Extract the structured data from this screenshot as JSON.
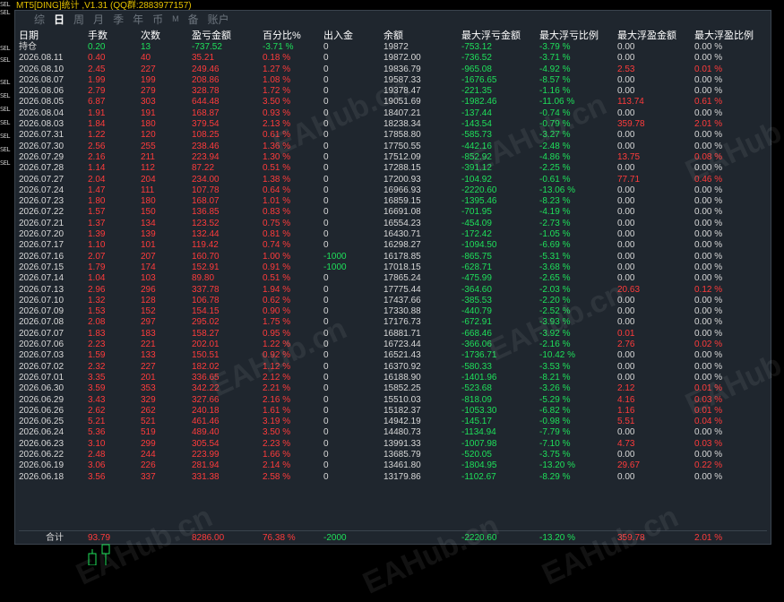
{
  "title": "MT5[DING]统计 ,V1.31 (QQ群:2883977157)",
  "tabs": [
    {
      "label": "综",
      "active": false
    },
    {
      "label": "日",
      "active": true
    },
    {
      "label": "周",
      "active": false
    },
    {
      "label": "月",
      "active": false
    },
    {
      "label": "季",
      "active": false
    },
    {
      "label": "年",
      "active": false
    },
    {
      "label": "币",
      "active": false
    },
    {
      "label": "M",
      "active": false
    },
    {
      "label": "备",
      "active": false
    },
    {
      "label": "账户",
      "active": false
    }
  ],
  "columns": [
    "日期",
    "手数",
    "次数",
    "盈亏金额",
    "百分比%",
    "出入金",
    "余额",
    "最大浮亏金额",
    "最大浮亏比例",
    "最大浮盈金额",
    "最大浮盈比例"
  ],
  "holding": [
    "持仓",
    "0.20",
    "13",
    "-737.52",
    "-3.71 %",
    "0",
    "19872",
    "-753.12",
    "-3.79 %",
    "0.00",
    "0.00 %"
  ],
  "rows": [
    [
      "2026.08.11",
      "0.40",
      "40",
      "35.21",
      "0.18 %",
      "0",
      "19872.00",
      "-736.52",
      "-3.71 %",
      "0.00",
      "0.00 %"
    ],
    [
      "2026.08.10",
      "2.45",
      "227",
      "249.46",
      "1.27 %",
      "0",
      "19836.79",
      "-965.08",
      "-4.92 %",
      "2.53",
      "0.01 %"
    ],
    [
      "2026.08.07",
      "1.99",
      "199",
      "208.86",
      "1.08 %",
      "0",
      "19587.33",
      "-1676.65",
      "-8.57 %",
      "0.00",
      "0.00 %"
    ],
    [
      "2026.08.06",
      "2.79",
      "279",
      "328.78",
      "1.72 %",
      "0",
      "19378.47",
      "-221.35",
      "-1.16 %",
      "0.00",
      "0.00 %"
    ],
    [
      "2026.08.05",
      "6.87",
      "303",
      "644.48",
      "3.50 %",
      "0",
      "19051.69",
      "-1982.46",
      "-11.06 %",
      "113.74",
      "0.61 %"
    ],
    [
      "2026.08.04",
      "1.91",
      "191",
      "168.87",
      "0.93 %",
      "0",
      "18407.21",
      "-137.44",
      "-0.74 %",
      "0.00",
      "0.00 %"
    ],
    [
      "2026.08.03",
      "1.84",
      "180",
      "379.54",
      "2.13 %",
      "0",
      "18238.34",
      "-143.54",
      "-0.79 %",
      "359.78",
      "2.01 %"
    ],
    [
      "2026.07.31",
      "1.22",
      "120",
      "108.25",
      "0.61 %",
      "0",
      "17858.80",
      "-585.73",
      "-3.27 %",
      "0.00",
      "0.00 %"
    ],
    [
      "2026.07.30",
      "2.56",
      "255",
      "238.46",
      "1.36 %",
      "0",
      "17750.55",
      "-442.16",
      "-2.48 %",
      "0.00",
      "0.00 %"
    ],
    [
      "2026.07.29",
      "2.16",
      "211",
      "223.94",
      "1.30 %",
      "0",
      "17512.09",
      "-852.92",
      "-4.86 %",
      "13.75",
      "0.08 %"
    ],
    [
      "2026.07.28",
      "1.14",
      "112",
      "87.22",
      "0.51 %",
      "0",
      "17288.15",
      "-391.12",
      "-2.25 %",
      "0.00",
      "0.00 %"
    ],
    [
      "2026.07.27",
      "2.04",
      "204",
      "234.00",
      "1.38 %",
      "0",
      "17200.93",
      "-104.92",
      "-0.61 %",
      "77.71",
      "0.46 %"
    ],
    [
      "2026.07.24",
      "1.47",
      "111",
      "107.78",
      "0.64 %",
      "0",
      "16966.93",
      "-2220.60",
      "-13.06 %",
      "0.00",
      "0.00 %"
    ],
    [
      "2026.07.23",
      "1.80",
      "180",
      "168.07",
      "1.01 %",
      "0",
      "16859.15",
      "-1395.46",
      "-8.23 %",
      "0.00",
      "0.00 %"
    ],
    [
      "2026.07.22",
      "1.57",
      "150",
      "136.85",
      "0.83 %",
      "0",
      "16691.08",
      "-701.95",
      "-4.19 %",
      "0.00",
      "0.00 %"
    ],
    [
      "2026.07.21",
      "1.37",
      "134",
      "123.52",
      "0.75 %",
      "0",
      "16554.23",
      "-454.09",
      "-2.73 %",
      "0.00",
      "0.00 %"
    ],
    [
      "2026.07.20",
      "1.39",
      "139",
      "132.44",
      "0.81 %",
      "0",
      "16430.71",
      "-172.42",
      "-1.05 %",
      "0.00",
      "0.00 %"
    ],
    [
      "2026.07.17",
      "1.10",
      "101",
      "119.42",
      "0.74 %",
      "0",
      "16298.27",
      "-1094.50",
      "-6.69 %",
      "0.00",
      "0.00 %"
    ],
    [
      "2026.07.16",
      "2.07",
      "207",
      "160.70",
      "1.00 %",
      "-1000",
      "16178.85",
      "-865.75",
      "-5.31 %",
      "0.00",
      "0.00 %"
    ],
    [
      "2026.07.15",
      "1.79",
      "174",
      "152.91",
      "0.91 %",
      "-1000",
      "17018.15",
      "-628.71",
      "-3.68 %",
      "0.00",
      "0.00 %"
    ],
    [
      "2026.07.14",
      "1.04",
      "103",
      "89.80",
      "0.51 %",
      "0",
      "17865.24",
      "-475.99",
      "-2.65 %",
      "0.00",
      "0.00 %"
    ],
    [
      "2026.07.13",
      "2.96",
      "296",
      "337.78",
      "1.94 %",
      "0",
      "17775.44",
      "-364.60",
      "-2.03 %",
      "20.63",
      "0.12 %"
    ],
    [
      "2026.07.10",
      "1.32",
      "128",
      "106.78",
      "0.62 %",
      "0",
      "17437.66",
      "-385.53",
      "-2.20 %",
      "0.00",
      "0.00 %"
    ],
    [
      "2026.07.09",
      "1.53",
      "152",
      "154.15",
      "0.90 %",
      "0",
      "17330.88",
      "-440.79",
      "-2.52 %",
      "0.00",
      "0.00 %"
    ],
    [
      "2026.07.08",
      "2.08",
      "297",
      "295.02",
      "1.75 %",
      "0",
      "17176.73",
      "-672.91",
      "-3.93 %",
      "0.00",
      "0.00 %"
    ],
    [
      "2026.07.07",
      "1.83",
      "183",
      "158.27",
      "0.95 %",
      "0",
      "16881.71",
      "-668.46",
      "-3.92 %",
      "0.01",
      "0.00 %"
    ],
    [
      "2026.07.06",
      "2.23",
      "221",
      "202.01",
      "1.22 %",
      "0",
      "16723.44",
      "-366.06",
      "-2.16 %",
      "2.76",
      "0.02 %"
    ],
    [
      "2026.07.03",
      "1.59",
      "133",
      "150.51",
      "0.92 %",
      "0",
      "16521.43",
      "-1736.71",
      "-10.42 %",
      "0.00",
      "0.00 %"
    ],
    [
      "2026.07.02",
      "2.32",
      "227",
      "182.02",
      "1.12 %",
      "0",
      "16370.92",
      "-580.33",
      "-3.53 %",
      "0.00",
      "0.00 %"
    ],
    [
      "2026.07.01",
      "3.35",
      "201",
      "336.65",
      "2.12 %",
      "0",
      "16188.90",
      "-1401.96",
      "-8.21 %",
      "0.00",
      "0.00 %"
    ],
    [
      "2026.06.30",
      "3.59",
      "353",
      "342.22",
      "2.21 %",
      "0",
      "15852.25",
      "-523.68",
      "-3.26 %",
      "2.12",
      "0.01 %"
    ],
    [
      "2026.06.29",
      "3.43",
      "329",
      "327.66",
      "2.16 %",
      "0",
      "15510.03",
      "-818.09",
      "-5.29 %",
      "4.16",
      "0.03 %"
    ],
    [
      "2026.06.26",
      "2.62",
      "262",
      "240.18",
      "1.61 %",
      "0",
      "15182.37",
      "-1053.30",
      "-6.82 %",
      "1.16",
      "0.01 %"
    ],
    [
      "2026.06.25",
      "5.21",
      "521",
      "461.46",
      "3.19 %",
      "0",
      "14942.19",
      "-145.17",
      "-0.98 %",
      "5.51",
      "0.04 %"
    ],
    [
      "2026.06.24",
      "5.36",
      "519",
      "489.40",
      "3.50 %",
      "0",
      "14480.73",
      "-1134.94",
      "-7.79 %",
      "0.00",
      "0.00 %"
    ],
    [
      "2026.06.23",
      "3.10",
      "299",
      "305.54",
      "2.23 %",
      "0",
      "13991.33",
      "-1007.98",
      "-7.10 %",
      "4.73",
      "0.03 %"
    ],
    [
      "2026.06.22",
      "2.48",
      "244",
      "223.99",
      "1.66 %",
      "0",
      "13685.79",
      "-520.05",
      "-3.75 %",
      "0.00",
      "0.00 %"
    ],
    [
      "2026.06.19",
      "3.06",
      "226",
      "281.94",
      "2.14 %",
      "0",
      "13461.80",
      "-1804.95",
      "-13.20 %",
      "29.67",
      "0.22 %"
    ],
    [
      "2026.06.18",
      "3.56",
      "337",
      "331.38",
      "2.58 %",
      "0",
      "13179.86",
      "-1102.67",
      "-8.29 %",
      "0.00",
      "0.00 %"
    ]
  ],
  "total": [
    "合计",
    "93.79",
    "",
    "8286.00",
    "76.38 %",
    "-2000",
    "",
    "-2220.60",
    "-13.20 %",
    "359.78",
    "2.01 %"
  ],
  "left_strip_labels": [
    "SEL",
    "SEL",
    "SEL",
    "SEL",
    "SEL",
    "SEL",
    "SEL",
    "SEL",
    "SEL",
    "SEL",
    "SEL"
  ],
  "watermark": "EAHub.cn",
  "colors": {
    "panel": "#1f262e",
    "green": "#1fe05a",
    "red": "#ff3b3b",
    "header": "#ffffff",
    "title": "#e6c200"
  }
}
